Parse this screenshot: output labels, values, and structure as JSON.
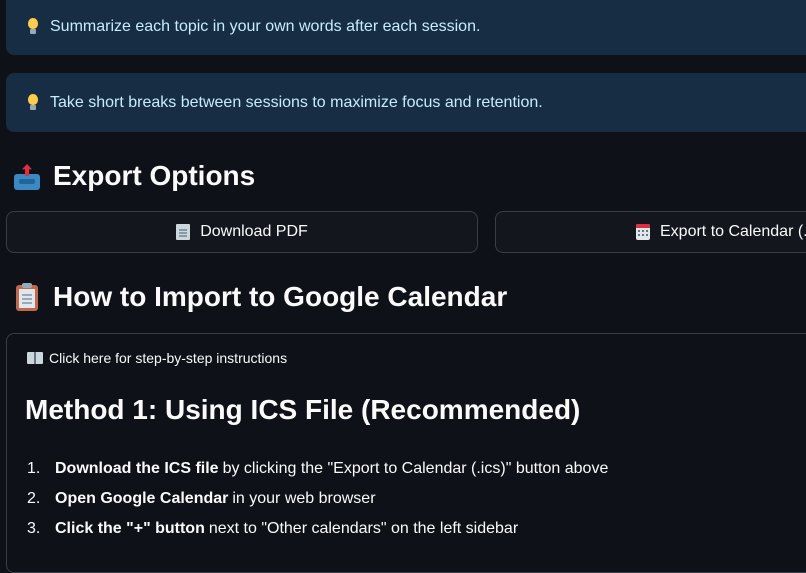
{
  "tips": [
    {
      "text": "Summarize each topic in your own words after each session."
    },
    {
      "text": "Take short breaks between sessions to maximize focus and retention."
    }
  ],
  "export": {
    "title": "Export Options",
    "download_pdf_label": "Download PDF",
    "export_calendar_label": "Export to Calendar (.ics)"
  },
  "import_section": {
    "title": "How to Import to Google Calendar",
    "expander_label": "Click here for step-by-step instructions",
    "method_title": "Method 1: Using ICS File (Recommended)",
    "steps": [
      {
        "num": "1.",
        "bold": "Download the ICS file",
        "rest": "by clicking the \"Export to Calendar (.ics)\" button above"
      },
      {
        "num": "2.",
        "bold": "Open Google Calendar",
        "rest": "in your web browser"
      },
      {
        "num": "3.",
        "bold": "Click the \"+\" button",
        "rest": "next to \"Other calendars\" on the left sidebar"
      }
    ]
  },
  "icons": {
    "tip": "lightbulb-icon",
    "export": "outbox-tray-icon",
    "pdf": "page-icon",
    "calendar": "calendar-icon",
    "import": "clipboard-icon",
    "expander": "open-book-icon"
  },
  "colors": {
    "background": "#0e1117",
    "tip_background": "#172d43",
    "tip_text": "#c7ebff",
    "border": "#3a3d46"
  }
}
